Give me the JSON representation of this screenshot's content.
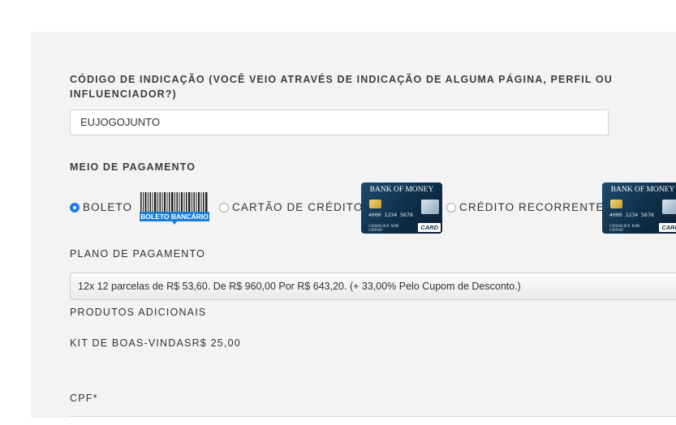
{
  "referral": {
    "label": "CÓDIGO DE INDICAÇÃO (VOCÊ VEIO ATRAVÉS DE INDICAÇÃO DE ALGUMA PÁGINA, PERFIL OU INFLUENCIADOR?)",
    "value": "EUJOGOJUNTO"
  },
  "payment_method": {
    "label": "MEIO DE PAGAMENTO",
    "options": [
      {
        "label": "BOLETO",
        "selected": true,
        "icon": "boleto-bancario-icon",
        "icon_text": "BOLETO BANCÁRIO"
      },
      {
        "label": "CARTÃO DE CRÉDITO",
        "selected": false,
        "icon": "credit-card-icon"
      },
      {
        "label": "CRÉDITO RECORRENTE",
        "selected": false,
        "icon": "credit-card-icon"
      }
    ],
    "card_image": {
      "bank": "BANK OF MONEY",
      "number": "4000 1234 5678",
      "expiry": "12/18",
      "holder_label": "CARDHOLDER NAME",
      "company": "COMPANY",
      "brand": "CARD"
    }
  },
  "payment_plan": {
    "label": "PLANO DE PAGAMENTO",
    "selected": "12x 12 parcelas de R$ 53,60. De R$ 960,00 Por R$ 643,20. (+ 33,00% Pelo Cupom de Desconto.)"
  },
  "additional_products": {
    "label": "PRODUTOS ADICIONAIS",
    "items": [
      {
        "name": "KIT DE BOAS-VINDAS",
        "price": "R$ 25,00"
      }
    ]
  },
  "cpf": {
    "label": "CPF*"
  },
  "colors": {
    "panel_bg": "#f3f3f3",
    "accent": "#1b7bef",
    "boleto_blue": "#1d7fd4"
  }
}
